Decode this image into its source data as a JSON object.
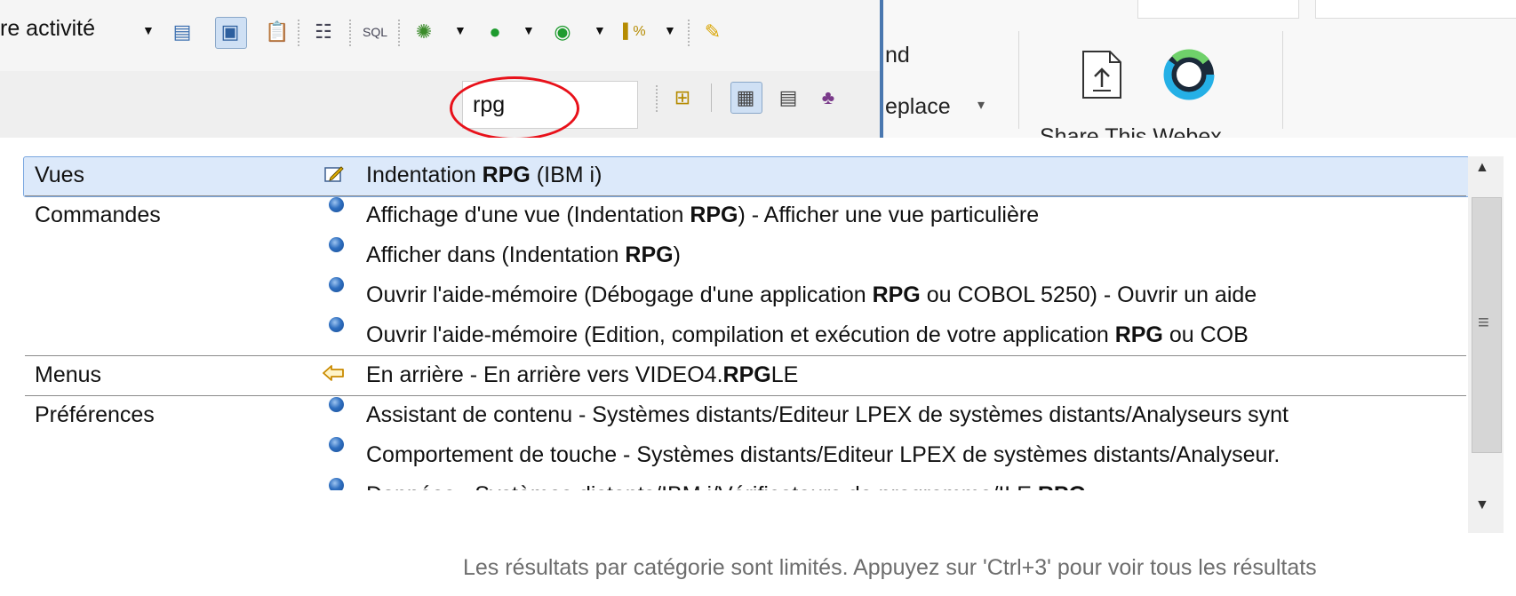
{
  "toolbar": {
    "perspective_label": "re activité",
    "search_value": "rpg",
    "icons": [
      "dropdown-arrow",
      "task-icon",
      "web-icon",
      "clipboard-icon",
      "list-icon",
      "sql-icon",
      "debug-icon",
      "run-icon",
      "run-remote-icon",
      "coverage-icon",
      "brush-icon"
    ]
  },
  "ribbon": {
    "find_label": "nd",
    "replace_label": "eplace",
    "share_label": "Share This Webex"
  },
  "popup": {
    "rows": [
      {
        "category": "Vues",
        "items": [
          {
            "pre": "Indentation ",
            "bold": "RPG",
            "post": " (IBM i)",
            "icon": "view-icon"
          }
        ]
      },
      {
        "category": "Commandes",
        "items": [
          {
            "pre": "Affichage d'une vue (Indentation ",
            "bold": "RPG",
            "post": ") - Afficher une vue particulière",
            "icon": "bullet-icon"
          },
          {
            "pre": "Afficher dans (Indentation ",
            "bold": "RPG",
            "post": ")",
            "icon": "bullet-icon"
          },
          {
            "pre": "Ouvrir l'aide-mémoire (Débogage d'une application ",
            "bold": "RPG",
            "post": " ou COBOL 5250) - Ouvrir un aide",
            "icon": "bullet-icon"
          },
          {
            "pre": "Ouvrir l'aide-mémoire (Edition, compilation et exécution de votre application ",
            "bold": "RPG",
            "post": " ou COB",
            "icon": "bullet-icon"
          }
        ]
      },
      {
        "category": "Menus",
        "items": [
          {
            "pre": "En arrière - En arrière vers VIDEO4.",
            "bold": "RPG",
            "post": "LE",
            "icon": "back-arrow-icon"
          }
        ]
      },
      {
        "category": "Préférences",
        "items": [
          {
            "pre": "Assistant de contenu - Systèmes distants/Editeur LPEX de systèmes distants/Analyseurs synt",
            "bold": "",
            "post": "",
            "icon": "bullet-icon"
          },
          {
            "pre": "Comportement de touche - Systèmes distants/Editeur LPEX de systèmes distants/Analyseur.",
            "bold": "",
            "post": "",
            "icon": "bullet-icon"
          },
          {
            "pre": "Données - Systèmes distants/IBM i/Vérificateurs de programme/ILE ",
            "bold": "RPG",
            "post": "",
            "icon": "bullet-icon"
          }
        ]
      }
    ],
    "footer": "Les résultats par catégorie sont limités. Appuyez sur 'Ctrl+3' pour voir tous les résultats"
  },
  "colors": {
    "selection_bg": "#dce9fa",
    "selection_border": "#7aa7e0",
    "highlight_circle": "#e8111a",
    "footer_text": "#6d6d6d"
  }
}
